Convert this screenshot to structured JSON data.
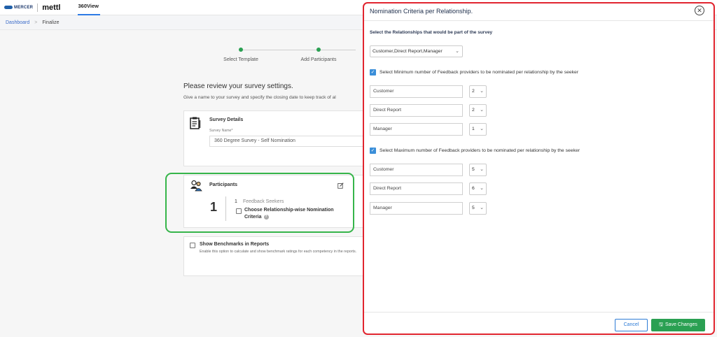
{
  "header": {
    "brand_mercer": "MERCER",
    "brand_mettl": "mettl",
    "app_name": "360View"
  },
  "breadcrumb": {
    "items": [
      "Dashboard",
      "Finalize"
    ],
    "separator": ">"
  },
  "steps": [
    {
      "label": "Select Template",
      "status": "done"
    },
    {
      "label": "Add Participants",
      "status": "done"
    }
  ],
  "review": {
    "title": "Please review your survey settings.",
    "subtitle": "Give a name to your survey and specify the closing date to keep track of al"
  },
  "survey_details": {
    "title": "Survey Details",
    "name_label": "Survey Name*",
    "name_value": "360 Degree Survey - Self Nomination"
  },
  "participants": {
    "title": "Participants",
    "seeker_count": "1",
    "seeker_count_small": "1",
    "seekers_label": "Feedback Seekers",
    "criteria_checkbox_label": "Choose Relationship-wise Nomination Criteria",
    "help_glyph": "?"
  },
  "benchmarks": {
    "label": "Show Benchmarks in Reports",
    "description": "Enable this option to calculate and show benchmark ratings for each competency in the reports."
  },
  "dialog": {
    "title": "Nomination Criteria per Relationship.",
    "close_glyph": "✕",
    "section_label": "Select the Relationships that would be part of the survey",
    "relationships_selected": "Customer,Direct Report,Manager",
    "check_glyph": "✓",
    "min_label": "Select Minimum number of Feedback providers to be nominated per relationship by the seeker",
    "min_rows": [
      {
        "relationship": "Customer",
        "value": "2"
      },
      {
        "relationship": "Direct Report",
        "value": "2"
      },
      {
        "relationship": "Manager",
        "value": "1"
      }
    ],
    "max_label": "Select Maximum number of Feedback providers to be nominated per relationship by the seeker",
    "max_rows": [
      {
        "relationship": "Customer",
        "value": "5"
      },
      {
        "relationship": "Direct Report",
        "value": "6"
      },
      {
        "relationship": "Manager",
        "value": "5"
      }
    ],
    "cancel_label": "Cancel",
    "save_label": "Save Changes",
    "save_icon_glyph": "🖫"
  },
  "colors": {
    "accent_blue": "#2e7cd6",
    "success_green": "#2aa052",
    "highlight_red": "#e1252f",
    "highlight_green": "#36b54a"
  }
}
